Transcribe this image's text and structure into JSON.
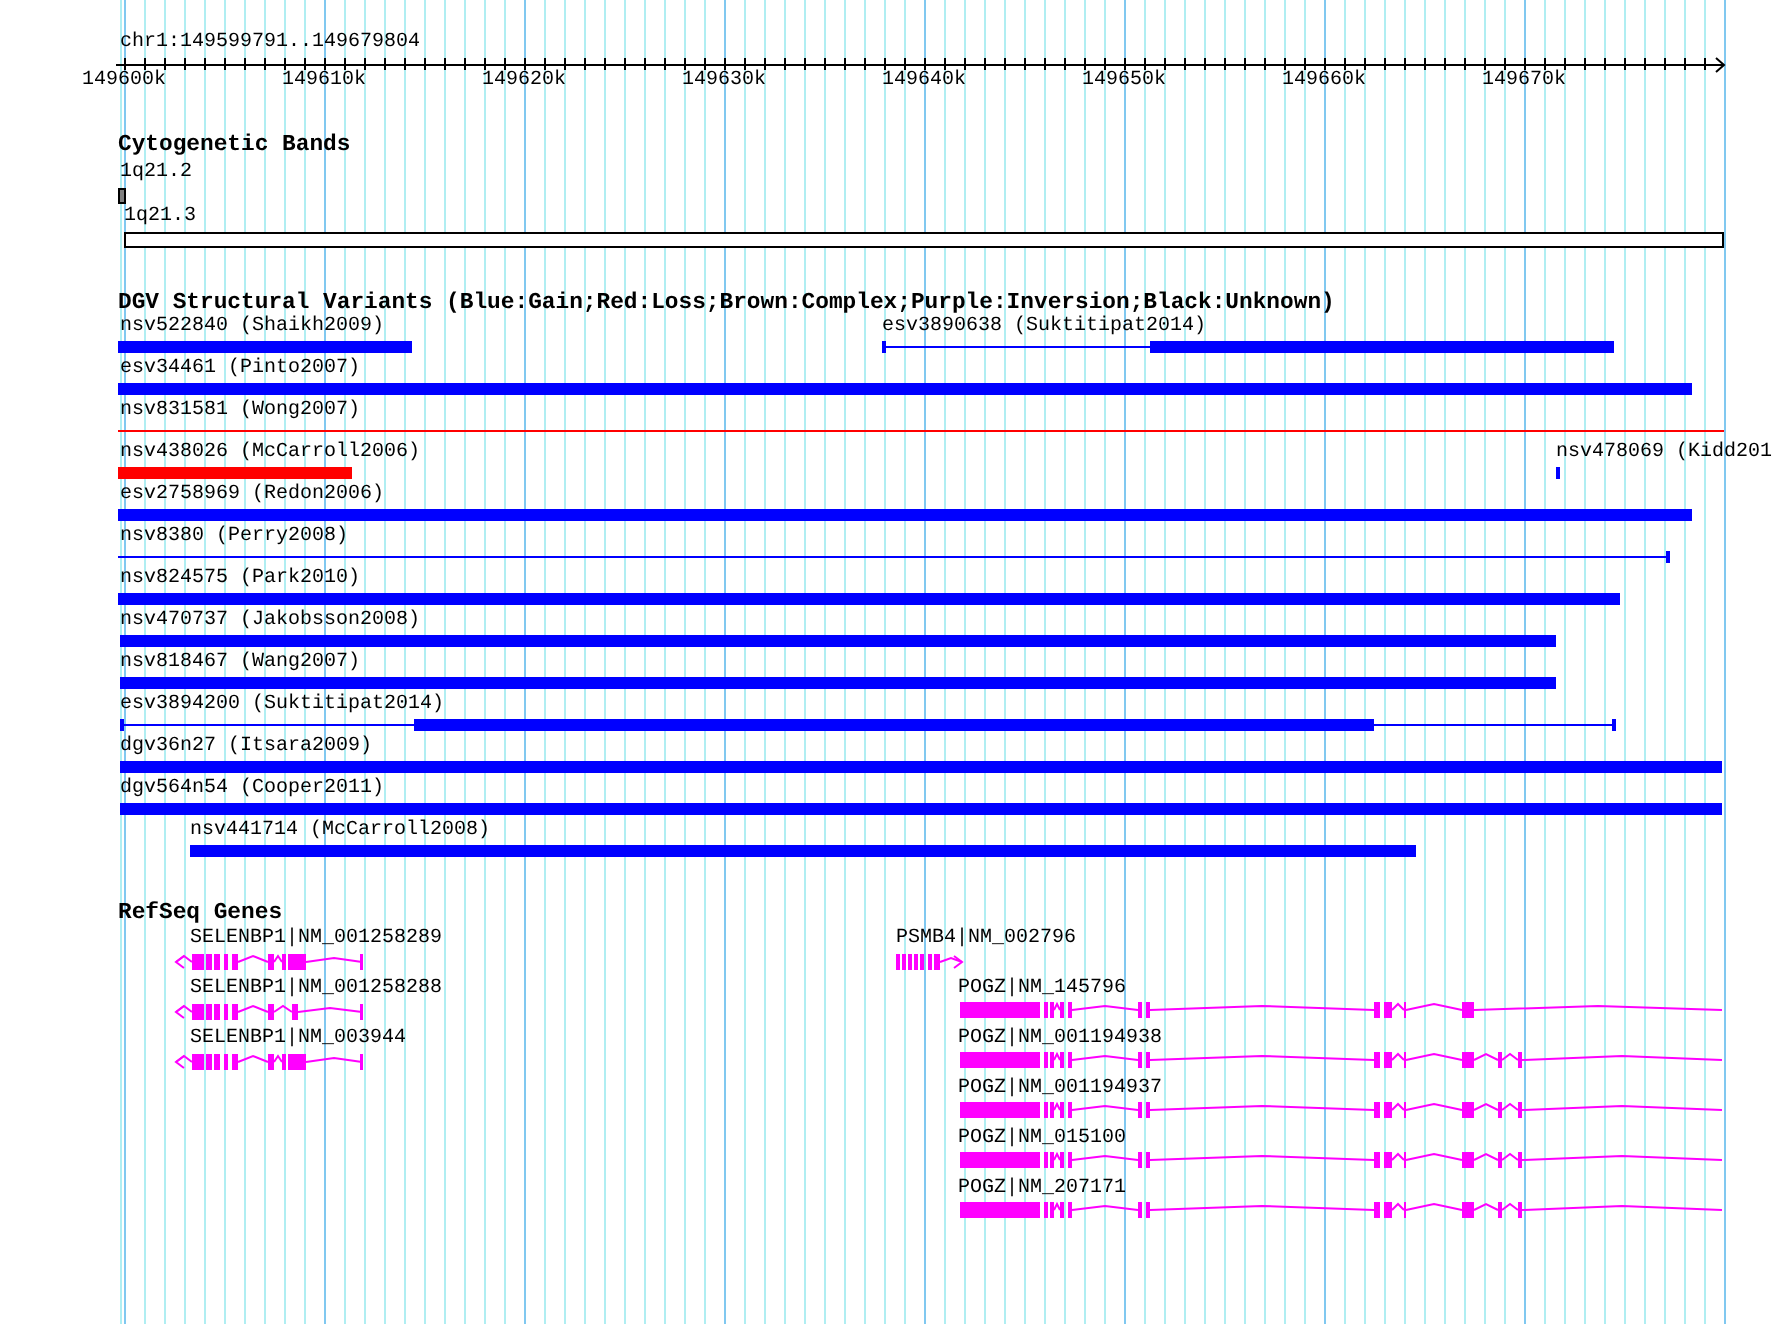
{
  "ruler": {
    "location": "chr1:149599791..149679804",
    "ticks": [
      "149600k",
      "149610k",
      "149620k",
      "149630k",
      "149640k",
      "149650k",
      "149660k",
      "149670k"
    ]
  },
  "cytobands": {
    "title": "Cytogenetic Bands",
    "bands": [
      {
        "label": "1q21.2",
        "color": "#808080"
      },
      {
        "label": "1q21.3",
        "color": "#ffffff"
      }
    ]
  },
  "variants": {
    "title": "DGV Structural Variants (Blue:Gain;Red:Loss;Brown:Complex;Purple:Inversion;Black:Unknown)",
    "rows": [
      {
        "items": [
          {
            "label": "nsv522840 (Shaikh2009)",
            "color": "#0000ff"
          },
          {
            "label": "esv3890638 (Suktitipat2014)",
            "color": "#0000ff"
          }
        ]
      },
      {
        "items": [
          {
            "label": "esv34461 (Pinto2007)",
            "color": "#0000ff"
          }
        ]
      },
      {
        "items": [
          {
            "label": "nsv831581 (Wong2007)",
            "color": "#ff0000"
          }
        ]
      },
      {
        "items": [
          {
            "label": "nsv438026 (McCarroll2006)",
            "color": "#ff0000"
          },
          {
            "label": "nsv478069 (Kidd201",
            "color": "#0000ff"
          }
        ]
      },
      {
        "items": [
          {
            "label": "esv2758969 (Redon2006)",
            "color": "#0000ff"
          }
        ]
      },
      {
        "items": [
          {
            "label": "nsv8380 (Perry2008)",
            "color": "#0000ff"
          }
        ]
      },
      {
        "items": [
          {
            "label": "nsv824575 (Park2010)",
            "color": "#0000ff"
          }
        ]
      },
      {
        "items": [
          {
            "label": "nsv470737 (Jakobsson2008)",
            "color": "#0000ff"
          }
        ]
      },
      {
        "items": [
          {
            "label": "nsv818467 (Wang2007)",
            "color": "#0000ff"
          }
        ]
      },
      {
        "items": [
          {
            "label": "esv3894200 (Suktitipat2014)",
            "color": "#0000ff"
          }
        ]
      },
      {
        "items": [
          {
            "label": "dgv36n27 (Itsara2009)",
            "color": "#0000ff"
          }
        ]
      },
      {
        "items": [
          {
            "label": "dgv564n54 (Cooper2011)",
            "color": "#0000ff"
          }
        ]
      },
      {
        "items": [
          {
            "label": "nsv441714 (McCarroll2008)",
            "color": "#0000ff"
          }
        ]
      }
    ]
  },
  "genes": {
    "title": "RefSeq Genes",
    "items": [
      {
        "label": "SELENBP1|NM_001258289",
        "kind": "reverse"
      },
      {
        "label": "SELENBP1|NM_001258288",
        "kind": "reverse"
      },
      {
        "label": "SELENBP1|NM_003944",
        "kind": "reverse"
      },
      {
        "label": "PSMB4|NM_002796",
        "kind": "forward"
      },
      {
        "label": "POGZ|NM_145796",
        "kind": "plain"
      },
      {
        "label": "POGZ|NM_001194938",
        "kind": "plain"
      },
      {
        "label": "POGZ|NM_001194937",
        "kind": "plain"
      },
      {
        "label": "POGZ|NM_015100",
        "kind": "plain"
      },
      {
        "label": "POGZ|NM_207171",
        "kind": "plain"
      }
    ]
  }
}
